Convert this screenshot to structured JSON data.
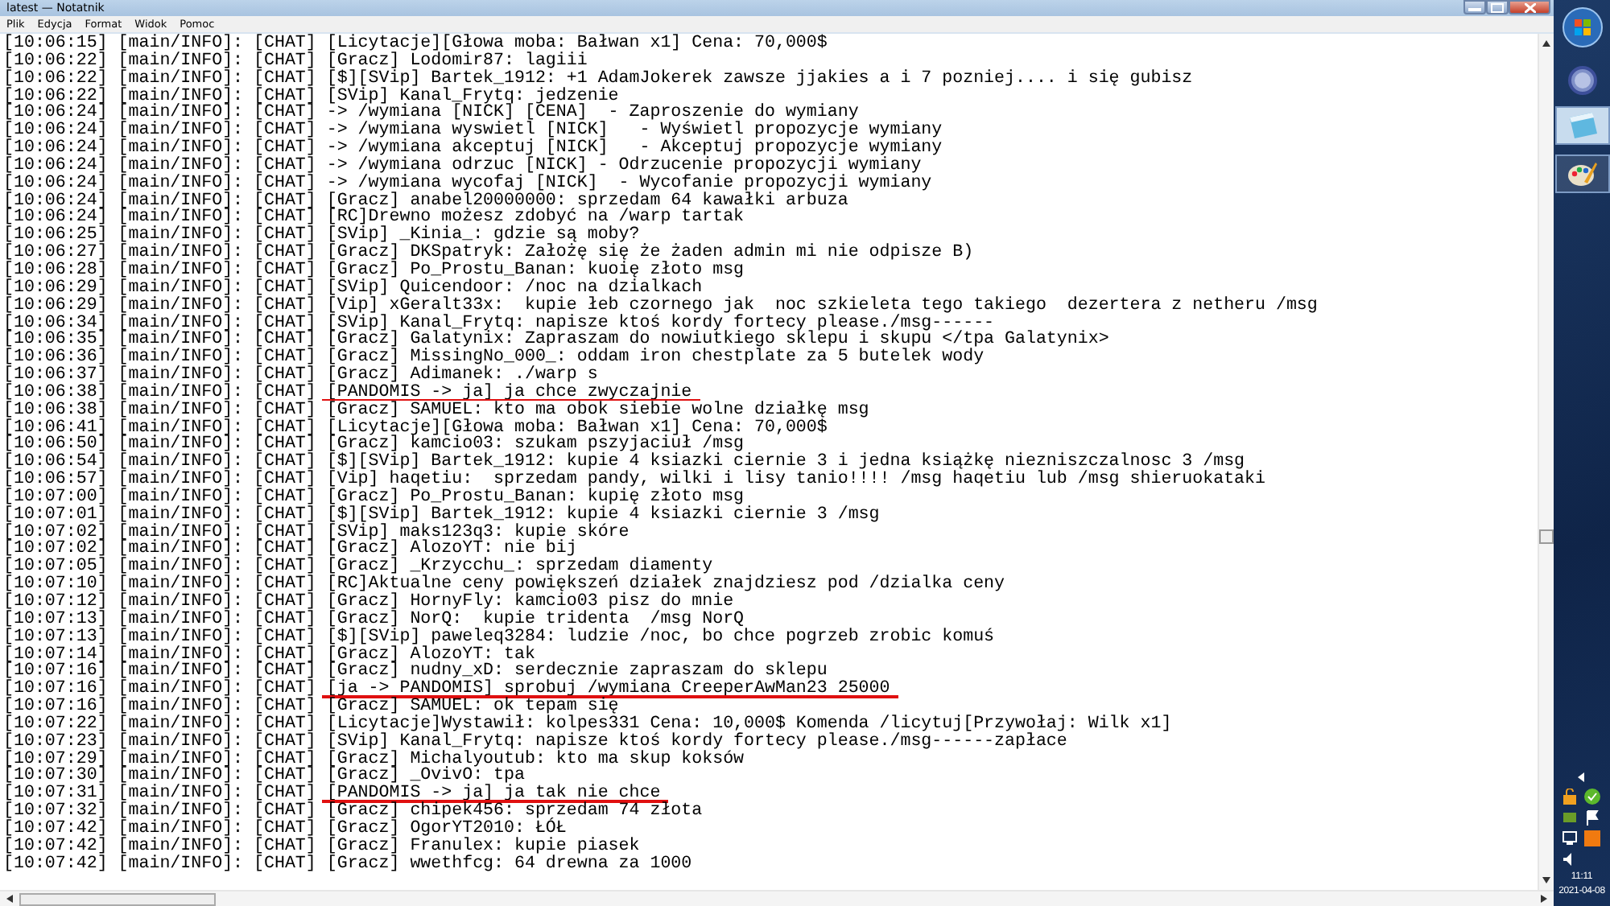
{
  "window": {
    "title": "latest — Notatnik"
  },
  "menu": [
    "Plik",
    "Edycja",
    "Format",
    "Widok",
    "Pomoc"
  ],
  "lines": [
    {
      "text": "[10:06:15] [main/INFO]: [CHAT] [Licytacje][Głowa moba: Bałwan x1] Cena: 70,000$",
      "underlined": false
    },
    {
      "text": "[10:06:22] [main/INFO]: [CHAT] [Gracz] Lodomir87: lagiii",
      "underlined": false
    },
    {
      "text": "[10:06:22] [main/INFO]: [CHAT] [$][SVip] Bartek_1912: +1 AdamJokerek zawsze jjakies a i 7 pozniej.... i się gubisz",
      "underlined": false
    },
    {
      "text": "[10:06:22] [main/INFO]: [CHAT] [SVip] Kanal_Frytq: jedzenie",
      "underlined": false
    },
    {
      "text": "[10:06:24] [main/INFO]: [CHAT] -> /wymiana [NICK] [CENA]  - Zaproszenie do wymiany",
      "underlined": false
    },
    {
      "text": "[10:06:24] [main/INFO]: [CHAT] -> /wymiana wyswietl [NICK]   - Wyświetl propozycje wymiany",
      "underlined": false
    },
    {
      "text": "[10:06:24] [main/INFO]: [CHAT] -> /wymiana akceptuj [NICK]   - Akceptuj propozycje wymiany",
      "underlined": false
    },
    {
      "text": "[10:06:24] [main/INFO]: [CHAT] -> /wymiana odrzuc [NICK] - Odrzucenie propozycji wymiany",
      "underlined": false
    },
    {
      "text": "[10:06:24] [main/INFO]: [CHAT] -> /wymiana wycofaj [NICK]  - Wycofanie propozycji wymiany",
      "underlined": false
    },
    {
      "text": "[10:06:24] [main/INFO]: [CHAT] [Gracz] anabel20000000: sprzedam 64 kawałki arbuza",
      "underlined": false
    },
    {
      "text": "[10:06:24] [main/INFO]: [CHAT] [RC]Drewno możesz zdobyć na /warp tartak",
      "underlined": false
    },
    {
      "text": "[10:06:25] [main/INFO]: [CHAT] [SVip] _Kinia_: gdzie są moby?",
      "underlined": false
    },
    {
      "text": "[10:06:27] [main/INFO]: [CHAT] [Gracz] DKSpatryk: Założę się że żaden admin mi nie odpisze B)",
      "underlined": false
    },
    {
      "text": "[10:06:28] [main/INFO]: [CHAT] [Gracz] Po_Prostu_Banan: kuoię złoto msg",
      "underlined": false
    },
    {
      "text": "[10:06:29] [main/INFO]: [CHAT] [SVip] Quicendoor: /noc na dzialkach",
      "underlined": false
    },
    {
      "text": "[10:06:29] [main/INFO]: [CHAT] [Vip] xGeralt33x:  kupie łeb czornego jak  noc szkieleta tego takiego  dezertera z netheru /msg",
      "underlined": false
    },
    {
      "text": "[10:06:34] [main/INFO]: [CHAT] [SVip] Kanal_Frytq: napisze ktoś kordy fortecy please./msg------",
      "underlined": false
    },
    {
      "text": "[10:06:35] [main/INFO]: [CHAT] [Gracz] Galatynix: Zapraszam do nowiutkiego sklepu i skupu </tpa Galatynix>",
      "underlined": false
    },
    {
      "text": "[10:06:36] [main/INFO]: [CHAT] [Gracz] MissingNo_000_: oddam iron chestplate za 5 butelek wody",
      "underlined": false
    },
    {
      "text": "[10:06:37] [main/INFO]: [CHAT] [Gracz] Adimanek: ./warp s",
      "underlined": false
    },
    {
      "text": "[10:06:38] [main/INFO]: [CHAT] [PANDOMIS -> ja] ja chce zwyczajnie",
      "underlined": true
    },
    {
      "text": "[10:06:38] [main/INFO]: [CHAT] [Gracz] SAMUEL: kto ma obok siebie wolne działkę msg",
      "underlined": false
    },
    {
      "text": "[10:06:41] [main/INFO]: [CHAT] [Licytacje][Głowa moba: Bałwan x1] Cena: 70,000$",
      "underlined": false
    },
    {
      "text": "[10:06:50] [main/INFO]: [CHAT] [Gracz] kamcio03: szukam pszyjaciuł /msg",
      "underlined": false
    },
    {
      "text": "[10:06:54] [main/INFO]: [CHAT] [$][SVip] Bartek_1912: kupie 4 ksiazki ciernie 3 i jedna książkę niezniszczalnosc 3 /msg",
      "underlined": false
    },
    {
      "text": "[10:06:57] [main/INFO]: [CHAT] [Vip] haqetiu:  sprzedam pandy, wilki i lisy tanio!!!! /msg haqetiu lub /msg shieruokataki",
      "underlined": false
    },
    {
      "text": "[10:07:00] [main/INFO]: [CHAT] [Gracz] Po_Prostu_Banan: kupię złoto msg",
      "underlined": false
    },
    {
      "text": "[10:07:01] [main/INFO]: [CHAT] [$][SVip] Bartek_1912: kupie 4 ksiazki ciernie 3 /msg",
      "underlined": false
    },
    {
      "text": "[10:07:02] [main/INFO]: [CHAT] [SVip] maks123q3: kupie skóre",
      "underlined": false
    },
    {
      "text": "[10:07:02] [main/INFO]: [CHAT] [Gracz] AlozoYT: nie bij",
      "underlined": false
    },
    {
      "text": "[10:07:05] [main/INFO]: [CHAT] [Gracz] _Krzycchu_: sprzedam diamenty",
      "underlined": false
    },
    {
      "text": "[10:07:10] [main/INFO]: [CHAT] [RC]Aktualne ceny powiększeń działek znajdziesz pod /dzialka ceny",
      "underlined": false
    },
    {
      "text": "[10:07:12] [main/INFO]: [CHAT] [Gracz] HornyFly: kamcio03 pisz do mnie",
      "underlined": false
    },
    {
      "text": "[10:07:13] [main/INFO]: [CHAT] [Gracz] NorQ:  kupie tridenta  /msg NorQ",
      "underlined": false
    },
    {
      "text": "[10:07:13] [main/INFO]: [CHAT] [$][SVip] paweleq3284: ludzie /noc, bo chce pogrzeb zrobic komuś",
      "underlined": false
    },
    {
      "text": "[10:07:14] [main/INFO]: [CHAT] [Gracz] AlozoYT: tak",
      "underlined": false
    },
    {
      "text": "[10:07:16] [main/INFO]: [CHAT] [Gracz] nudny_xD: serdecznie zapraszam do sklepu",
      "underlined": false
    },
    {
      "text": "[10:07:16] [main/INFO]: [CHAT] [ja -> PANDOMIS] sprobuj /wymiana CreeperAwMan23 25000",
      "underlined": true
    },
    {
      "text": "[10:07:16] [main/INFO]: [CHAT] [Gracz] SAMUEL: ok tepam się",
      "underlined": false
    },
    {
      "text": "[10:07:22] [main/INFO]: [CHAT] [Licytacje]Wystawił: kolpes331 Cena: 10,000$ Komenda /licytuj[Przywołaj: Wilk x1]",
      "underlined": false
    },
    {
      "text": "[10:07:23] [main/INFO]: [CHAT] [SVip] Kanal_Frytq: napisze ktoś kordy fortecy please./msg------zapłace",
      "underlined": false
    },
    {
      "text": "[10:07:29] [main/INFO]: [CHAT] [Gracz] Michalyoutub: kto ma skup koksów",
      "underlined": false
    },
    {
      "text": "[10:07:30] [main/INFO]: [CHAT] [Gracz] _OvivO: tpa",
      "underlined": false
    },
    {
      "text": "[10:07:31] [main/INFO]: [CHAT] [PANDOMIS -> ja] ja tak nie chce",
      "underlined": true
    },
    {
      "text": "[10:07:32] [main/INFO]: [CHAT] [Gracz] chipek456: sprzedam 74 złota",
      "underlined": false
    },
    {
      "text": "[10:07:42] [main/INFO]: [CHAT] [Gracz] OgorYT2010: ŁÓŁ",
      "underlined": false
    },
    {
      "text": "[10:07:42] [main/INFO]: [CHAT] [Gracz] Franulex: kupie piasek",
      "underlined": false
    },
    {
      "text": "[10:07:42] [main/INFO]: [CHAT] [Gracz] wwethfcg: 64 drewna za 1000",
      "underlined": false
    }
  ],
  "taskbar": {
    "time": "11:11",
    "date": "2021-04-08"
  }
}
